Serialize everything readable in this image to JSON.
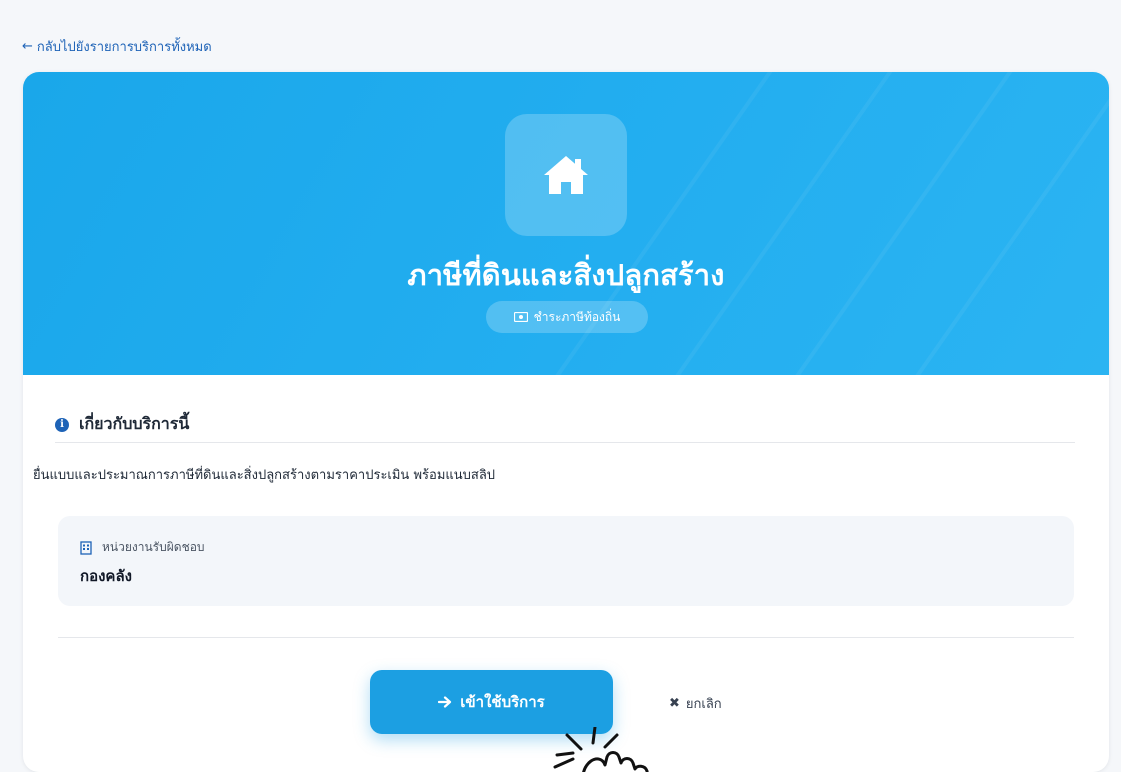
{
  "nav": {
    "back_label": "กลับไปยังรายการบริการทั้งหมด",
    "back_icon": "arrow-left-icon"
  },
  "hero": {
    "icon": "home-icon",
    "title": "ภาษีที่ดินและสิ่งปลูกสร้าง",
    "category_icon": "money-icon",
    "category_label": "ชำระภาษีท้องถิ่น",
    "colors": {
      "gradient_start": "#1aa7ea",
      "gradient_end": "#2bb4f2"
    }
  },
  "about": {
    "icon": "info-icon",
    "heading": "เกี่ยวกับบริการนี้",
    "description": "ยื่นแบบและประมาณการภาษีที่ดินและสิ่งปลูกสร้างตามราคาประเมิน พร้อมแนบสลิป"
  },
  "department": {
    "icon": "building-icon",
    "label": "หน่วยงานรับผิดชอบ",
    "value": "กองคลัง"
  },
  "actions": {
    "enter_label": "เข้าใช้บริการ",
    "enter_icon": "arrow-right-icon",
    "cancel_label": "ยกเลิก",
    "cancel_icon": "close-icon",
    "accent_color": "#1c9fe2"
  }
}
